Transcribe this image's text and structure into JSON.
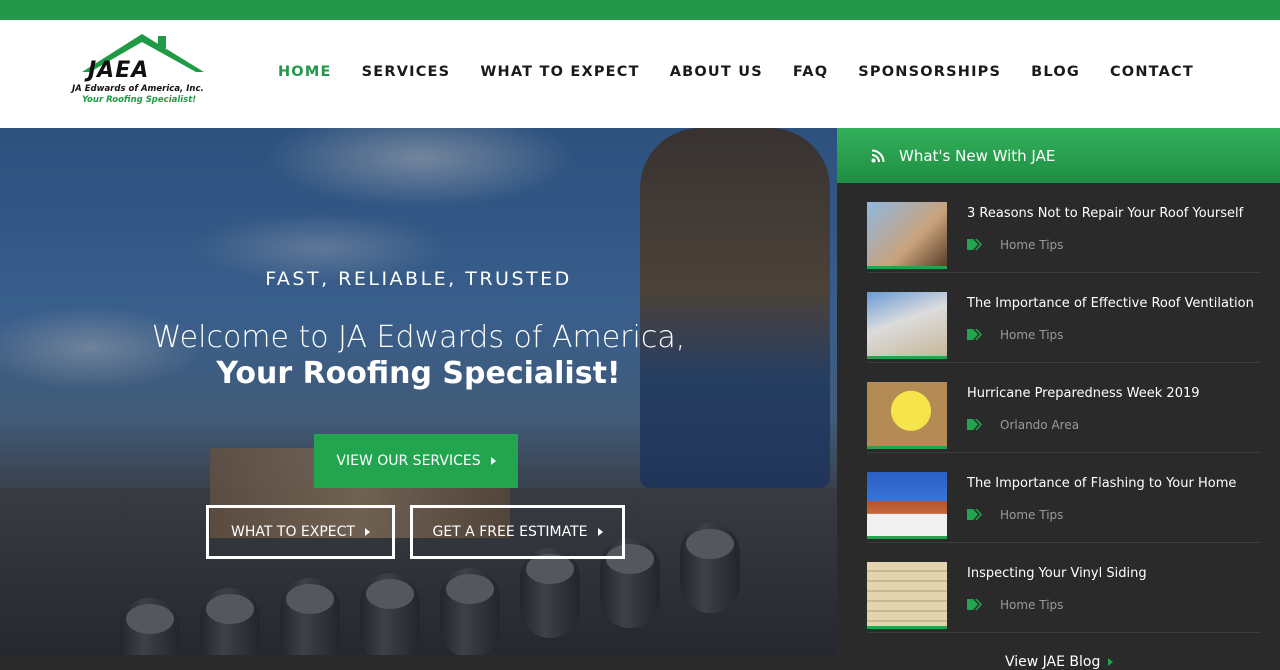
{
  "colors": {
    "brand_green": "#23974a",
    "button_green": "#23a54f",
    "sidebar_bg": "#2a2a2a"
  },
  "logo": {
    "mark": "JAEA",
    "line1": "JA Edwards of America, Inc.",
    "line2": "Your Roofing Specialist!"
  },
  "nav": {
    "items": [
      "HOME",
      "SERVICES",
      "WHAT TO EXPECT",
      "ABOUT US",
      "FAQ",
      "SPONSORSHIPS",
      "BLOG",
      "CONTACT"
    ],
    "active": "HOME"
  },
  "hero": {
    "tagline": "FAST, RELIABLE, TRUSTED",
    "headline_line1": "Welcome to JA Edwards of America,",
    "headline_line2": "Your Roofing Specialist!",
    "primary_button": "VIEW OUR SERVICES",
    "secondary_buttons": [
      "WHAT TO EXPECT",
      "GET A FREE ESTIMATE"
    ]
  },
  "sidebar": {
    "title": "What's New With JAE",
    "icon": "rss-icon",
    "posts": [
      {
        "title": "3 Reasons Not to Repair Your Roof Yourself",
        "category": "Home Tips"
      },
      {
        "title": "The Importance of Effective Roof Ventilation",
        "category": "Home Tips"
      },
      {
        "title": "Hurricane Preparedness Week 2019",
        "category": "Orlando Area"
      },
      {
        "title": "The Importance of Flashing to Your Home",
        "category": "Home Tips"
      },
      {
        "title": "Inspecting Your Vinyl Siding",
        "category": "Home Tips"
      }
    ],
    "view_blog": "View JAE Blog"
  }
}
